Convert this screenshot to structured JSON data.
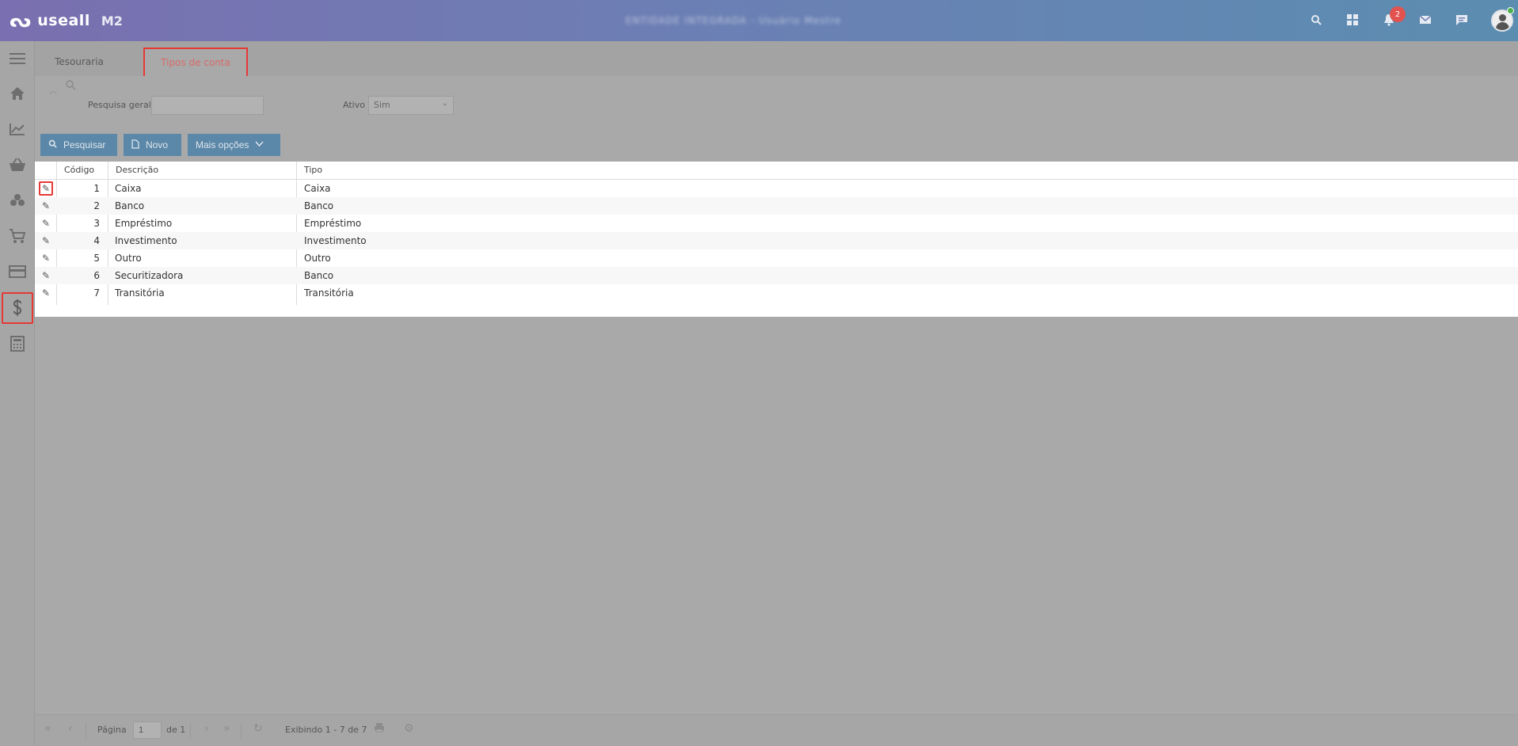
{
  "header": {
    "logo_mark": "ᔓ",
    "brand": "useall",
    "version": "M2",
    "blurred_text": "ENTIDADE INTEGRADA - Usuário Mestre",
    "notification_count": "2",
    "icons": [
      "search-icon",
      "apps-icon",
      "bell-icon",
      "mail-icon",
      "chat-icon"
    ]
  },
  "sidebar": {
    "items": [
      {
        "icon": "menu-icon",
        "glyph": "≡"
      },
      {
        "icon": "home-icon",
        "glyph": "⌂"
      },
      {
        "icon": "chart-icon",
        "glyph": "📈"
      },
      {
        "icon": "basket-icon",
        "glyph": "🧺"
      },
      {
        "icon": "boxes-icon",
        "glyph": "⧈"
      },
      {
        "icon": "cart-icon",
        "glyph": "🛒"
      },
      {
        "icon": "card-icon",
        "glyph": "▭"
      },
      {
        "icon": "dollar-icon",
        "glyph": "$"
      },
      {
        "icon": "calculator-icon",
        "glyph": "▦"
      }
    ]
  },
  "tabs": [
    {
      "label": "Tesouraria"
    },
    {
      "label": "Tipos de conta"
    }
  ],
  "filter": {
    "general_search_label": "Pesquisa geral",
    "general_search_value": "",
    "active_label": "Ativo",
    "active_value": "Sim"
  },
  "toolbar": {
    "search_label": "Pesquisar",
    "new_label": "Novo",
    "more_label": "Mais opções"
  },
  "grid": {
    "columns": [
      "Código",
      "Descrição",
      "Tipo"
    ],
    "rows": [
      {
        "code": "1",
        "description": "Caixa",
        "type": "Caixa"
      },
      {
        "code": "2",
        "description": "Banco",
        "type": "Banco"
      },
      {
        "code": "3",
        "description": "Empréstimo",
        "type": "Empréstimo"
      },
      {
        "code": "4",
        "description": "Investimento",
        "type": "Investimento"
      },
      {
        "code": "5",
        "description": "Outro",
        "type": "Outro"
      },
      {
        "code": "6",
        "description": "Securitizadora",
        "type": "Banco"
      },
      {
        "code": "7",
        "description": "Transitória",
        "type": "Transitória"
      }
    ]
  },
  "pager": {
    "page_label": "Página",
    "page_value": "1",
    "of_label": "de 1",
    "display_text": "Exibindo 1 - 7 de 7"
  },
  "colors": {
    "header_start": "#7a6fb0",
    "header_end": "#5b8db0",
    "button": "#5b87a8",
    "highlight": "#e53935",
    "badge": "#e2524f"
  }
}
